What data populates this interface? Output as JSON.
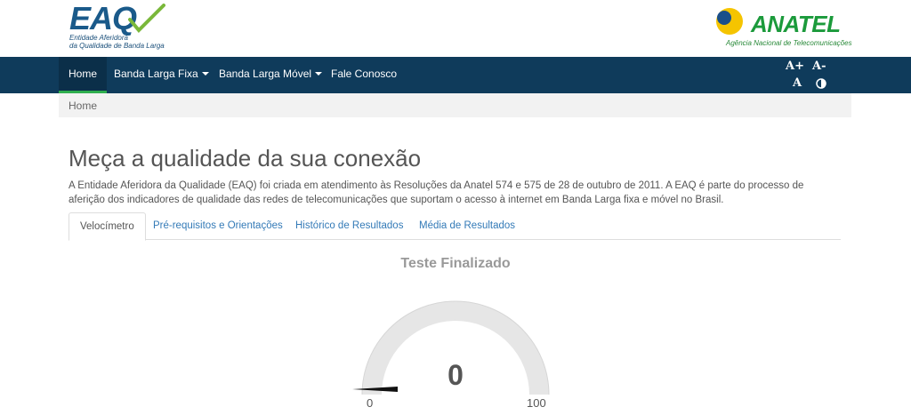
{
  "header": {
    "eaq_logo_text": "EAQ",
    "eaq_subtitle_line1": "Entidade Aferidora",
    "eaq_subtitle_line2": "da Qualidade de Banda Larga",
    "anatel_name": "ANATEL",
    "anatel_subtitle": "Agência Nacional de Telecomunicações"
  },
  "nav": {
    "items": [
      {
        "label": "Home",
        "active": true
      },
      {
        "label": "Banda Larga Fixa",
        "dropdown": true
      },
      {
        "label": "Banda Larga Móvel",
        "dropdown": true
      },
      {
        "label": "Fale Conosco"
      }
    ],
    "accessibility": {
      "increase_font": "A+",
      "decrease_font": "A-",
      "reset_font": "A",
      "contrast_icon": "contrast-icon"
    }
  },
  "breadcrumb": {
    "current": "Home"
  },
  "main": {
    "title": "Meça a qualidade da sua conexão",
    "intro": "A Entidade Aferidora da Qualidade (EAQ) foi criada em atendimento às Resoluções da Anatel 574 e 575 de 28 de outubro de 2011. A EAQ é parte do processo de aferição dos indicadores de qualidade das redes de telecomunicações que suportam o acesso à internet em Banda Larga fixa e móvel no Brasil.",
    "tabs": [
      {
        "label": "Velocímetro",
        "active": true
      },
      {
        "label": "Pré-requisitos e Orientações"
      },
      {
        "label": "Histórico de Resultados"
      },
      {
        "label": "Média de Resultados"
      }
    ]
  },
  "speedtest": {
    "status": "Teste Finalizado",
    "value": "0",
    "min_label": "0",
    "max_label": "100",
    "min": 0,
    "max": 100,
    "current": 0
  },
  "colors": {
    "navbar": "#0f3b5b",
    "nav_active_underline": "#2fae4e",
    "link": "#337ab7",
    "eaq_blue": "#1a5a8a",
    "anatel_green": "#1b9a3b",
    "anatel_yellow": "#f5c400"
  }
}
